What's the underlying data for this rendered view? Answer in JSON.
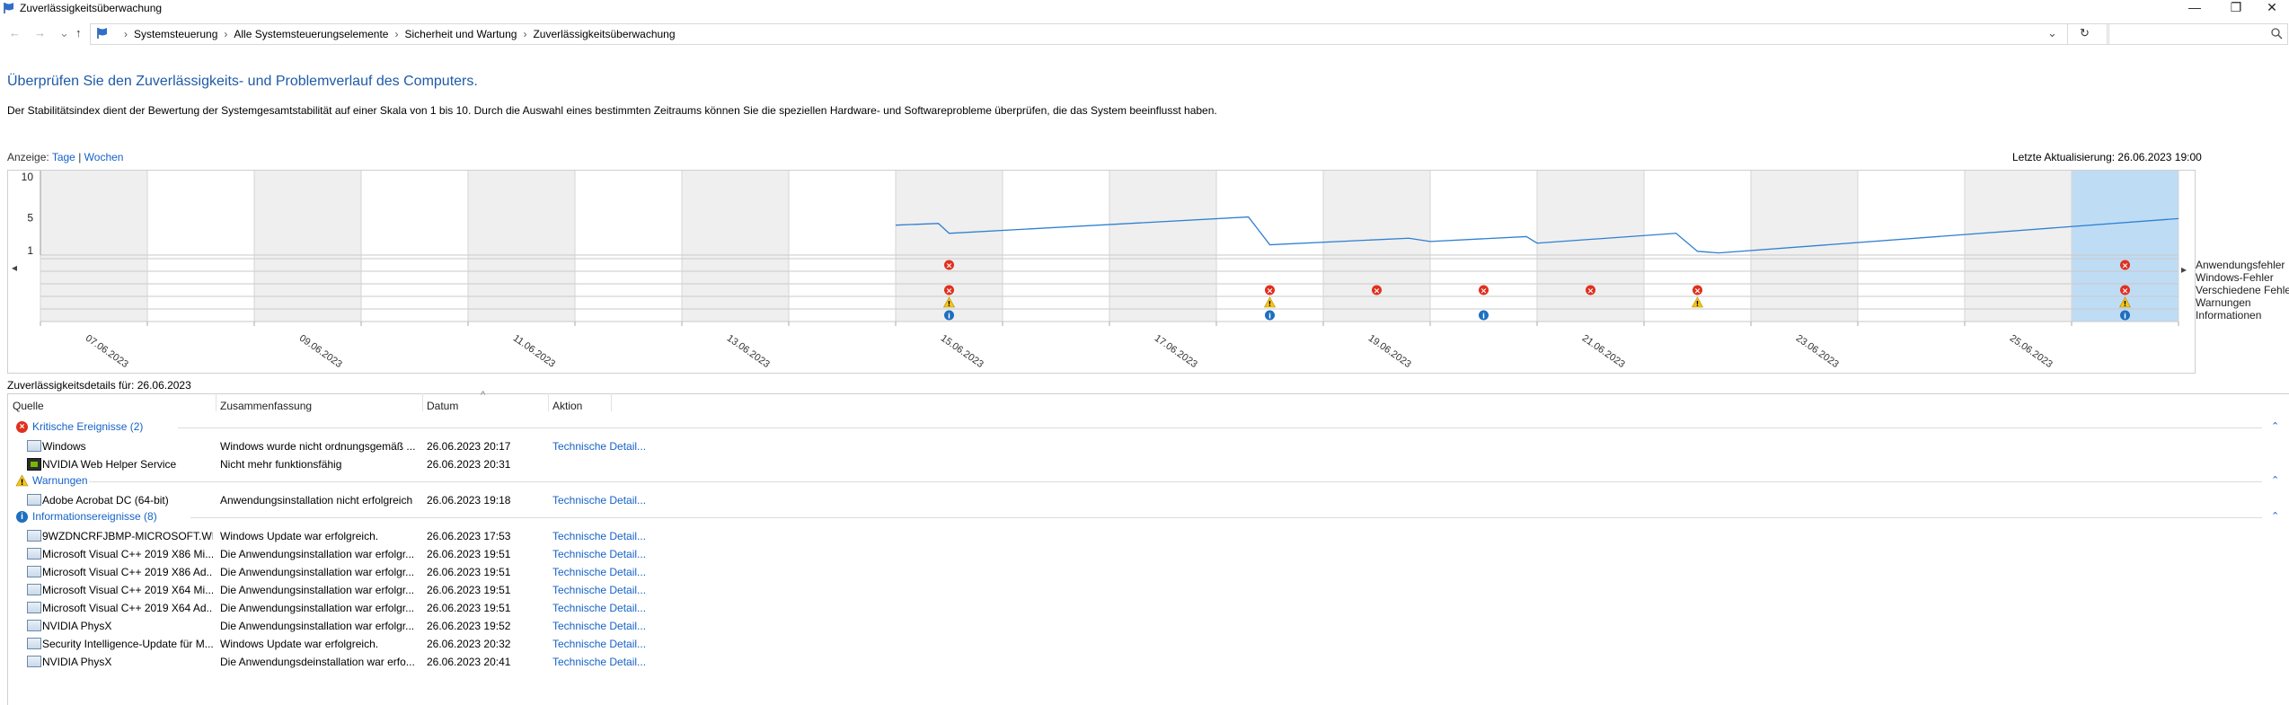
{
  "window": {
    "title": "Zuverlässigkeitsüberwachung",
    "minimize_glyph": "—",
    "maximize_glyph": "❐",
    "close_glyph": "✕"
  },
  "nav": {
    "back_glyph": "←",
    "forward_glyph": "→",
    "dropdown_glyph": "⌄",
    "up_glyph": "↑",
    "refresh_glyph": "↻",
    "breadcrumbs": [
      "Systemsteuerung",
      "Alle Systemsteuerungselemente",
      "Sicherheit und Wartung",
      "Zuverlässigkeitsüberwachung"
    ],
    "search_placeholder": ""
  },
  "header": {
    "title": "Überprüfen Sie den Zuverlässigkeits- und Problemverlauf des Computers.",
    "description": "Der Stabilitätsindex dient der Bewertung der Systemgesamtstabilität auf einer Skala von 1 bis 10. Durch die Auswahl eines bestimmten Zeitraums können Sie die speziellen Hardware- und Softwareprobleme überprüfen, die das System beeinflusst haben.",
    "view_label": "Anzeige:",
    "view_days": "Tage",
    "view_separator": "|",
    "view_weeks": "Wochen",
    "last_update": "Letzte Aktualisierung: 26.06.2023 19:00"
  },
  "chart_data": {
    "type": "line",
    "y_ticks": [
      "10",
      "5",
      "1"
    ],
    "ylim": [
      1,
      10
    ],
    "columns": 20,
    "selected_column": 19,
    "x_tick_labels": [
      {
        "col": 0,
        "label": "07.06.2023"
      },
      {
        "col": 2,
        "label": "09.06.2023"
      },
      {
        "col": 4,
        "label": "11.06.2023"
      },
      {
        "col": 6,
        "label": "13.06.2023"
      },
      {
        "col": 8,
        "label": "15.06.2023"
      },
      {
        "col": 10,
        "label": "17.06.2023"
      },
      {
        "col": 12,
        "label": "19.06.2023"
      },
      {
        "col": 14,
        "label": "21.06.2023"
      },
      {
        "col": 16,
        "label": "23.06.2023"
      },
      {
        "col": 18,
        "label": "25.06.2023"
      }
    ],
    "stability_line": [
      [
        8.0,
        4.0
      ],
      [
        8.4,
        4.2
      ],
      [
        8.5,
        3.0
      ],
      [
        11.3,
        5.0
      ],
      [
        11.5,
        1.6
      ],
      [
        12.8,
        2.4
      ],
      [
        13.0,
        2.0
      ],
      [
        13.9,
        2.6
      ],
      [
        14.0,
        1.8
      ],
      [
        15.3,
        3.0
      ],
      [
        15.5,
        0.8
      ],
      [
        15.7,
        0.6
      ],
      [
        20.0,
        4.8
      ]
    ],
    "event_rows": [
      {
        "name": "Anwendungsfehler",
        "type": "error",
        "cols": [
          8,
          19
        ]
      },
      {
        "name": "Windows-Fehler",
        "type": "error",
        "cols": []
      },
      {
        "name": "Verschiedene Fehler",
        "type": "error",
        "cols": [
          8,
          11,
          12,
          13,
          14,
          15,
          19
        ]
      },
      {
        "name": "Warnungen",
        "type": "warning",
        "cols": [
          8,
          11,
          15,
          19
        ]
      },
      {
        "name": "Informationen",
        "type": "info",
        "cols": [
          8,
          11,
          13,
          19
        ]
      }
    ],
    "scroll_left": "◂",
    "scroll_right": "▸"
  },
  "details": {
    "title": "Zuverlässigkeitsdetails für: 26.06.2023",
    "sort_glyph": "^",
    "columns": [
      "Quelle",
      "Zusammenfassung",
      "Datum",
      "Aktion"
    ],
    "groups": [
      {
        "label": "Kritische Ereignisse (2)",
        "type": "error",
        "rows": [
          {
            "source": "Windows",
            "summary": "Windows wurde nicht ordnungsgemäß ...",
            "date": "26.06.2023 20:17",
            "action": "Technische Detail...",
            "icon": "app"
          },
          {
            "source": "NVIDIA Web Helper Service",
            "summary": "Nicht mehr funktionsfähig",
            "date": "26.06.2023 20:31",
            "action": "",
            "icon": "nvidia"
          }
        ]
      },
      {
        "label": "Warnungen",
        "type": "warning",
        "rows": [
          {
            "source": "Adobe Acrobat DC (64-bit)",
            "summary": "Anwendungsinstallation nicht erfolgreich",
            "date": "26.06.2023 19:18",
            "action": "Technische Detail...",
            "icon": "app"
          }
        ]
      },
      {
        "label": "Informationsereignisse (8)",
        "type": "info",
        "rows": [
          {
            "source": "9WZDNCRFJBMP-MICROSOFT.WI...",
            "summary": "Windows Update war erfolgreich.",
            "date": "26.06.2023 17:53",
            "action": "Technische Detail...",
            "icon": "app"
          },
          {
            "source": "Microsoft Visual C++ 2019 X86 Mi...",
            "summary": "Die Anwendungsinstallation war erfolgr...",
            "date": "26.06.2023 19:51",
            "action": "Technische Detail...",
            "icon": "app"
          },
          {
            "source": "Microsoft Visual C++ 2019 X86 Ad...",
            "summary": "Die Anwendungsinstallation war erfolgr...",
            "date": "26.06.2023 19:51",
            "action": "Technische Detail...",
            "icon": "app"
          },
          {
            "source": "Microsoft Visual C++ 2019 X64 Mi...",
            "summary": "Die Anwendungsinstallation war erfolgr...",
            "date": "26.06.2023 19:51",
            "action": "Technische Detail...",
            "icon": "app"
          },
          {
            "source": "Microsoft Visual C++ 2019 X64 Ad...",
            "summary": "Die Anwendungsinstallation war erfolgr...",
            "date": "26.06.2023 19:51",
            "action": "Technische Detail...",
            "icon": "app"
          },
          {
            "source": "NVIDIA PhysX",
            "summary": "Die Anwendungsinstallation war erfolgr...",
            "date": "26.06.2023 19:52",
            "action": "Technische Detail...",
            "icon": "app"
          },
          {
            "source": "Security Intelligence-Update für M...",
            "summary": "Windows Update war erfolgreich.",
            "date": "26.06.2023 20:32",
            "action": "Technische Detail...",
            "icon": "app"
          },
          {
            "source": "NVIDIA PhysX",
            "summary": "Die Anwendungsdeinstallation war erfo...",
            "date": "26.06.2023 20:41",
            "action": "Technische Detail...",
            "icon": "app"
          }
        ]
      }
    ]
  },
  "colors": {
    "link": "#1562c7",
    "heading": "#1e5aa8",
    "line": "#2f7fd1",
    "selected": "#bfdcf5",
    "shade": "#efefef",
    "error": "#e0301e",
    "warning": "#f5c518",
    "info": "#1f6fbf"
  }
}
